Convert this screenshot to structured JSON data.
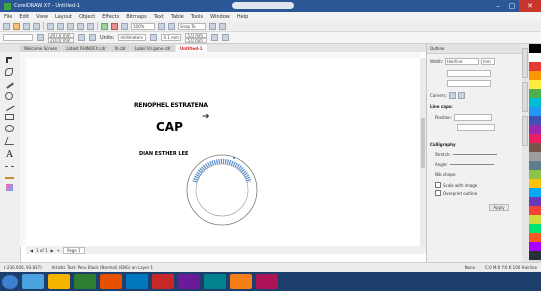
{
  "window": {
    "title": "CorelDRAW X7 - Untitled-1",
    "title_center": ""
  },
  "menu": [
    "File",
    "Edit",
    "View",
    "Layout",
    "Object",
    "Effects",
    "Bitmaps",
    "Text",
    "Table",
    "Tools",
    "Window",
    "Help"
  ],
  "property_bar": {
    "width": "297.0 mm",
    "height": "210.0 mm",
    "units_label": "Units:",
    "units_value": "millimeters",
    "nudge": "0.1 mm",
    "dup_x": "5.0 mm",
    "dup_y": "5.0 mm"
  },
  "toolbar": {
    "zoom": "100%",
    "snap_label": "Snap To"
  },
  "doc_tabs": [
    "Welcome Screen",
    "Latest RHINOFX.cdr",
    "Ill.cdr",
    "Label Vir.gone.cdr",
    "Untitled-1"
  ],
  "canvas": {
    "line1": "RENOPHEL ESTRATENA",
    "line2": "CAP",
    "line3": "DIAN ESTHER LEE",
    "seal_text": "REPUBLIC OF PHILIPPINES"
  },
  "page_nav": {
    "counter": "1 of 1",
    "page_tab": "Page 1"
  },
  "status": {
    "coords": "(-230.000, 93.837)",
    "hint": "Artistic Text: Peru Black (Normal) (ENG) on Layer 1",
    "fill": "None",
    "outline": "C:0 M:0 Y:0 K:100  Hairline"
  },
  "docker": {
    "title": "Outline",
    "width_label": "Width:",
    "width_value": "Hairline",
    "units": "mm",
    "corners_label": "Corners:",
    "line_caps_label": "Line caps:",
    "position_label": "Position:",
    "calligraphy_label": "Calligraphy",
    "stretch_label": "Stretch:",
    "angle_label": "Angle:",
    "nib_label": "Nib shape:",
    "scale_label": "Scale with image",
    "overprint_label": "Overprint outline",
    "apply_label": "Apply"
  },
  "palette": [
    "#000000",
    "#ffffff",
    "#e53935",
    "#ff9800",
    "#ffeb3b",
    "#4caf50",
    "#00bcd4",
    "#2196f3",
    "#3f51b5",
    "#9c27b0",
    "#e91e63",
    "#795548",
    "#9e9e9e",
    "#607d8b",
    "#8bc34a",
    "#ffc107",
    "#03a9f4",
    "#673ab7",
    "#f44336",
    "#cddc39",
    "#00e676",
    "#ff5722",
    "#aa00ff",
    "#263238"
  ],
  "taskbar_icons": [
    "#4aa3df",
    "#f4b400",
    "#2e7d32",
    "#e65100",
    "#0277bd",
    "#c62828",
    "#6a1b9a",
    "#00838f",
    "#f57f17",
    "#ad1457"
  ],
  "tray": {
    "time": "",
    "date": ""
  },
  "accent": "#2b5797"
}
